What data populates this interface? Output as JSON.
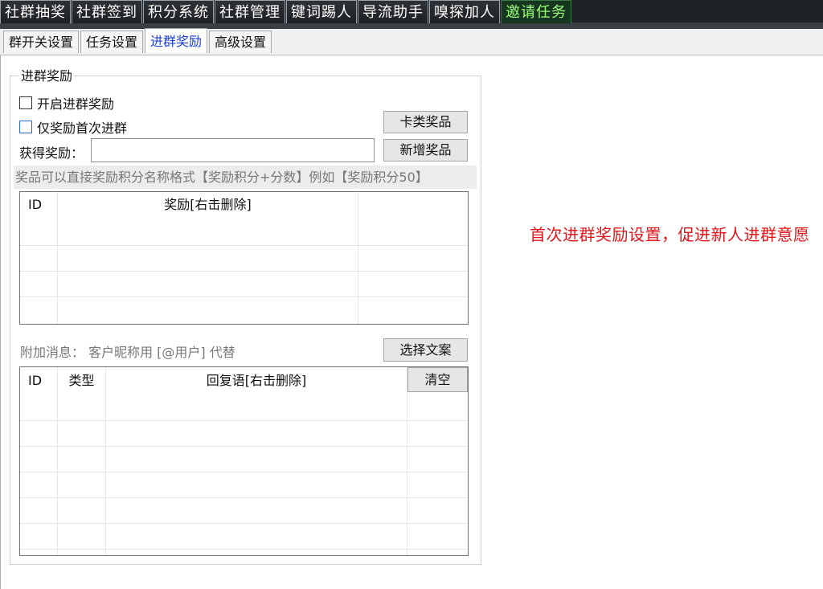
{
  "top_tabs": [
    {
      "label": "社群抽奖",
      "active": false
    },
    {
      "label": "社群签到",
      "active": false
    },
    {
      "label": "积分系统",
      "active": false
    },
    {
      "label": "社群管理",
      "active": false
    },
    {
      "label": "键词踢人",
      "active": false
    },
    {
      "label": "导流助手",
      "active": false
    },
    {
      "label": "嗅探加人",
      "active": false
    },
    {
      "label": "邀请任务",
      "active": true
    }
  ],
  "sub_tabs": [
    {
      "label": "群开关设置",
      "active": false
    },
    {
      "label": "任务设置",
      "active": false
    },
    {
      "label": "进群奖励",
      "active": true
    },
    {
      "label": "高级设置",
      "active": false
    }
  ],
  "group": {
    "title": "进群奖励",
    "enable_reward_label": "开启进群奖励",
    "first_join_only_label": "仅奖励首次进群",
    "card_prize_button": "卡类奖品",
    "reward_label": "获得奖励：",
    "reward_input_value": "",
    "add_prize_button": "新增奖品",
    "hint": "奖品可以直接奖励积分名称格式【奖励积分+分数】例如【奖励积分50】"
  },
  "reward_table": {
    "columns": [
      "ID",
      "奖励[右击删除]",
      ""
    ],
    "rows": []
  },
  "extra_message": {
    "label": "附加消息：  客户昵称用  [@用户] 代替",
    "select_copy_button": "选择文案",
    "clear_button": "清空"
  },
  "reply_table": {
    "columns": [
      "ID",
      "类型",
      "回复语[右击删除]"
    ],
    "rows": []
  },
  "annotation": "首次进群奖励设置，促进新人进群意愿",
  "colors": {
    "topbar_bg": "#1f2326",
    "active_top_tab_text": "#9dff7a",
    "active_sub_tab_text": "#1a3fd0",
    "annotation_text": "#e0161b"
  }
}
